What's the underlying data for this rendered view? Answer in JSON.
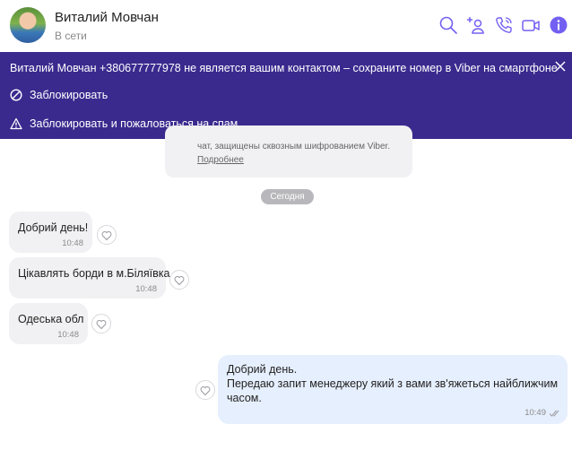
{
  "contact": {
    "name": "Виталий Мовчан",
    "status": "В сети"
  },
  "header_icons": [
    "search-icon",
    "add-participant-icon",
    "phone-call-icon",
    "video-call-icon",
    "info-icon"
  ],
  "colors": {
    "accent": "#7360f2",
    "banner_bg": "#3a2a8e",
    "incoming_bubble": "#f1f1f3",
    "outgoing_bubble": "#e6effd"
  },
  "banner": {
    "message": "Виталий Мовчан +380677777978 не является вашим контактом – сохраните номер в Viber на смартфоне",
    "block_label": "Заблокировать",
    "block_report_label": "Заблокировать и пожаловаться на спам"
  },
  "system_notice": {
    "text": "чат, защищены сквозным шифрованием Viber.",
    "link": "Подробнее"
  },
  "date_divider": "Сегодня",
  "messages": [
    {
      "text": "Добрий день!",
      "time": "10:48"
    },
    {
      "text": "Цікавлять борди в м.Біляївка",
      "time": "10:48"
    },
    {
      "text": "Одеська обл",
      "time": "10:48"
    }
  ],
  "outgoing": {
    "line1": "Добрий день.",
    "line2": "Передаю запит менеджеру який з вами зв'яжеться найближчим",
    "line3": "часом.",
    "time": "10:49"
  }
}
